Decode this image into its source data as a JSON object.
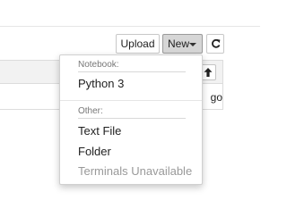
{
  "toolbar": {
    "upload_label": "Upload",
    "new_label": "New",
    "refresh_icon": "refresh-icon"
  },
  "file_list": {
    "sort_icon": "arrow-up-icon",
    "row_partial_text": "go"
  },
  "dropdown": {
    "notebook_header": "Notebook:",
    "python_label": "Python 3",
    "other_header": "Other:",
    "text_file_label": "Text File",
    "folder_label": "Folder",
    "terminals_label": "Terminals Unavailable"
  },
  "colors": {
    "active_button_bg": "#d6d6d6",
    "disabled_text": "#999999",
    "header_text": "#777777"
  }
}
